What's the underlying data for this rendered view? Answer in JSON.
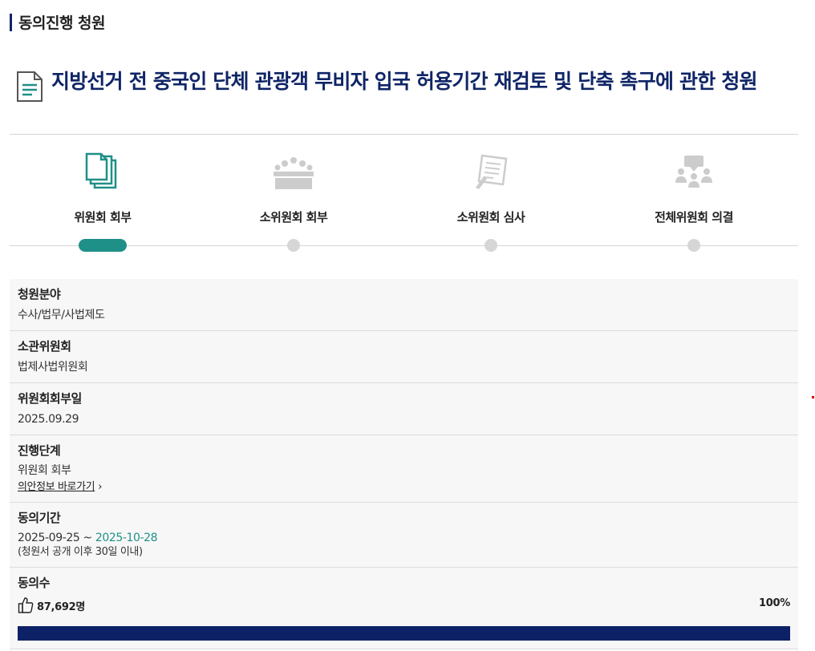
{
  "section": {
    "title": "동의진행 청원"
  },
  "petition": {
    "title": "지방선거 전 중국인 단체 관광객 무비자 입국 허용기간 재검토 및 단축 촉구에 관한 청원"
  },
  "steps": [
    {
      "label": "위원회 회부",
      "icon": "documents-icon",
      "active": true
    },
    {
      "label": "소위원회 회부",
      "icon": "meeting-table-icon",
      "active": false
    },
    {
      "label": "소위원회 심사",
      "icon": "review-pen-icon",
      "active": false
    },
    {
      "label": "전체위원회 의결",
      "icon": "presentation-icon",
      "active": false
    }
  ],
  "info": {
    "field": {
      "label": "청원분야",
      "value": "수사/법무/사법제도"
    },
    "committee": {
      "label": "소관위원회",
      "value": "법제사법위원회"
    },
    "referral_date": {
      "label": "위원회회부일",
      "value": "2025.09.29"
    },
    "stage": {
      "label": "진행단계",
      "value": "위원회 회부",
      "link_label": "의안정보 바로가기",
      "link_chevron": "›"
    },
    "period": {
      "label": "동의기간",
      "start": "2025-09-25",
      "separator": " ~ ",
      "end": "2025-10-28",
      "note": "(청원서 공개 이후 30일 이내)"
    },
    "agree": {
      "label": "동의수",
      "count": "87,692명",
      "percent": "100%",
      "progress": 1.0
    }
  },
  "colors": {
    "navy": "#0f2566",
    "teal": "#1f9088",
    "progress": "#0d2266",
    "inactive": "#d6d6d6"
  }
}
